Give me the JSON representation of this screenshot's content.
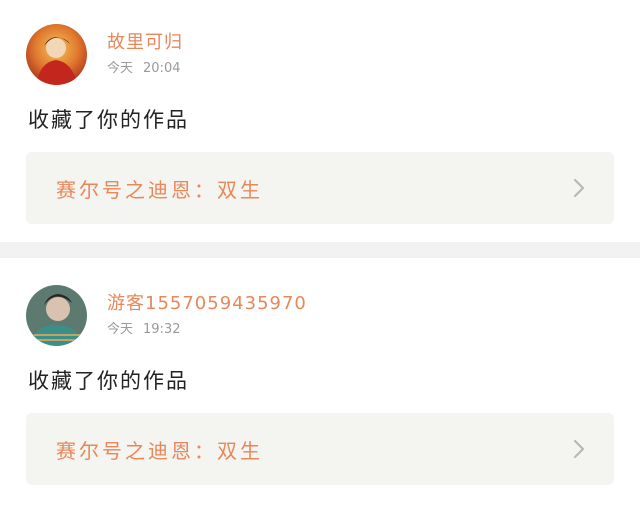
{
  "notifications": [
    {
      "user": "故里可归",
      "day": "今天",
      "time": "20:04",
      "action": "收藏了你的作品",
      "work_title": "赛尔号之迪恩：双生"
    },
    {
      "user": "游客1557059435970",
      "day": "今天",
      "time": "19:32",
      "action": "收藏了你的作品",
      "work_title": "赛尔号之迪恩：双生"
    }
  ],
  "colors": {
    "accent": "#e8875a",
    "muted": "#9a9a9a",
    "card_bg": "#f4f4f0",
    "divider": "#f2f2f2"
  },
  "icons": [
    "avatar",
    "chevron-right-icon"
  ]
}
